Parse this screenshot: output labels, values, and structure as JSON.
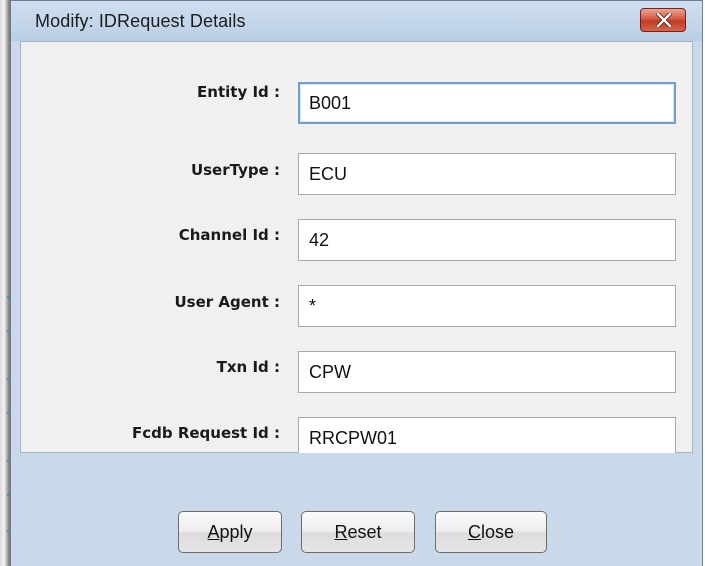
{
  "window": {
    "title": "Modify: IDRequest Details",
    "close_icon": "close-x-icon",
    "close_color": "#c84a30"
  },
  "form": {
    "fields": [
      {
        "label": "Entity Id :",
        "value": "B001"
      },
      {
        "label": "UserType :",
        "value": "ECU"
      },
      {
        "label": "Channel Id :",
        "value": "42"
      },
      {
        "label": "User Agent :",
        "value": "*"
      },
      {
        "label": "Txn Id :",
        "value": "CPW"
      },
      {
        "label": "Fcdb Request Id :",
        "value": "RRCPW01"
      }
    ]
  },
  "buttons": {
    "apply": {
      "mnemonic": "A",
      "rest": "pply"
    },
    "reset": {
      "mnemonic": "R",
      "rest": "eset"
    },
    "close": {
      "mnemonic": "C",
      "rest": "lose"
    }
  }
}
